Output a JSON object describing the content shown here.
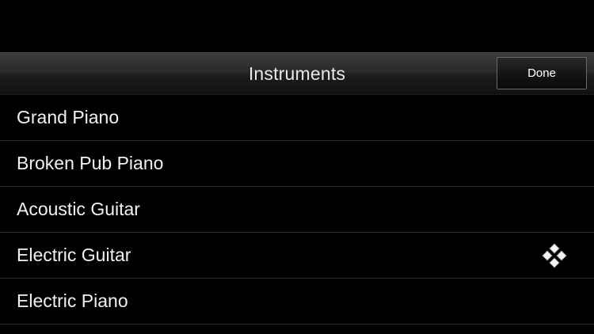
{
  "navbar": {
    "title": "Instruments",
    "done_label": "Done"
  },
  "instruments": [
    {
      "label": "Grand Piano",
      "selected": false
    },
    {
      "label": "Broken Pub Piano",
      "selected": false
    },
    {
      "label": "Acoustic Guitar",
      "selected": false
    },
    {
      "label": "Electric Guitar",
      "selected": true,
      "icon": "four-diamonds-icon"
    },
    {
      "label": "Electric Piano",
      "selected": false
    }
  ],
  "colors": {
    "background": "#000000",
    "text": "#f2f2f2",
    "separator": "#2e2e2e"
  }
}
